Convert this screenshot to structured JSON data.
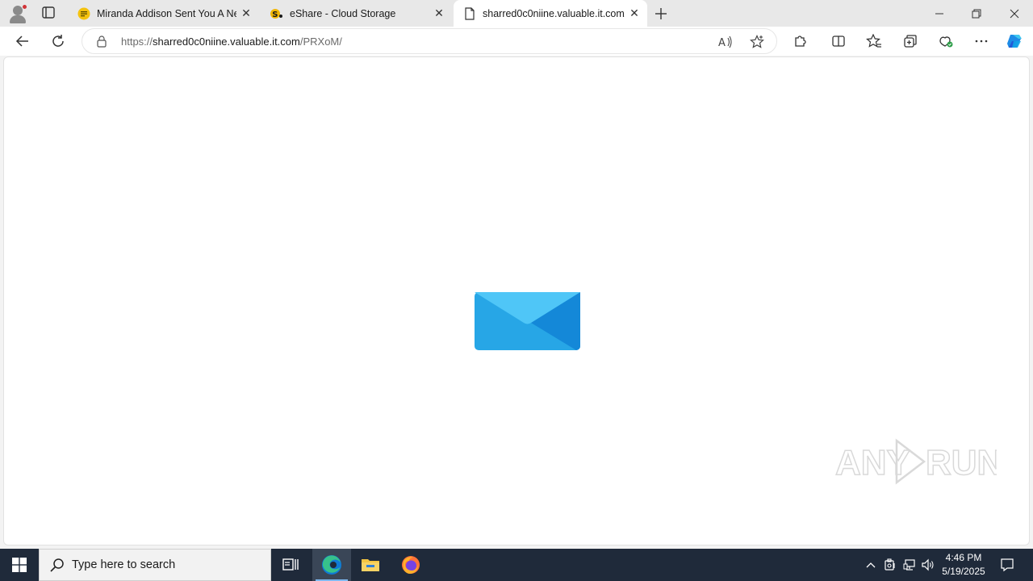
{
  "browser": {
    "tabs": [
      {
        "title": "Miranda Addison Sent You A New",
        "icon": "notes-icon",
        "active": false
      },
      {
        "title": "eShare - Cloud Storage",
        "icon": "eshare-icon",
        "active": false
      },
      {
        "title": "sharred0c0niine.valuable.it.com/",
        "icon": "page-icon",
        "active": true
      }
    ],
    "address": {
      "scheme": "https://",
      "host": "sharred0c0niine.valuable.it.com",
      "path": "/PRXoM/"
    }
  },
  "page": {
    "icon": "envelope-icon",
    "colors": {
      "envelope_light": "#4fc6f7",
      "envelope_mid": "#27a6e6",
      "envelope_dark": "#1488d8"
    }
  },
  "watermark": {
    "text_left": "ANY",
    "text_right": "RUN"
  },
  "taskbar": {
    "search_placeholder": "Type here to search",
    "time": "4:46 PM",
    "date": "5/19/2025"
  }
}
